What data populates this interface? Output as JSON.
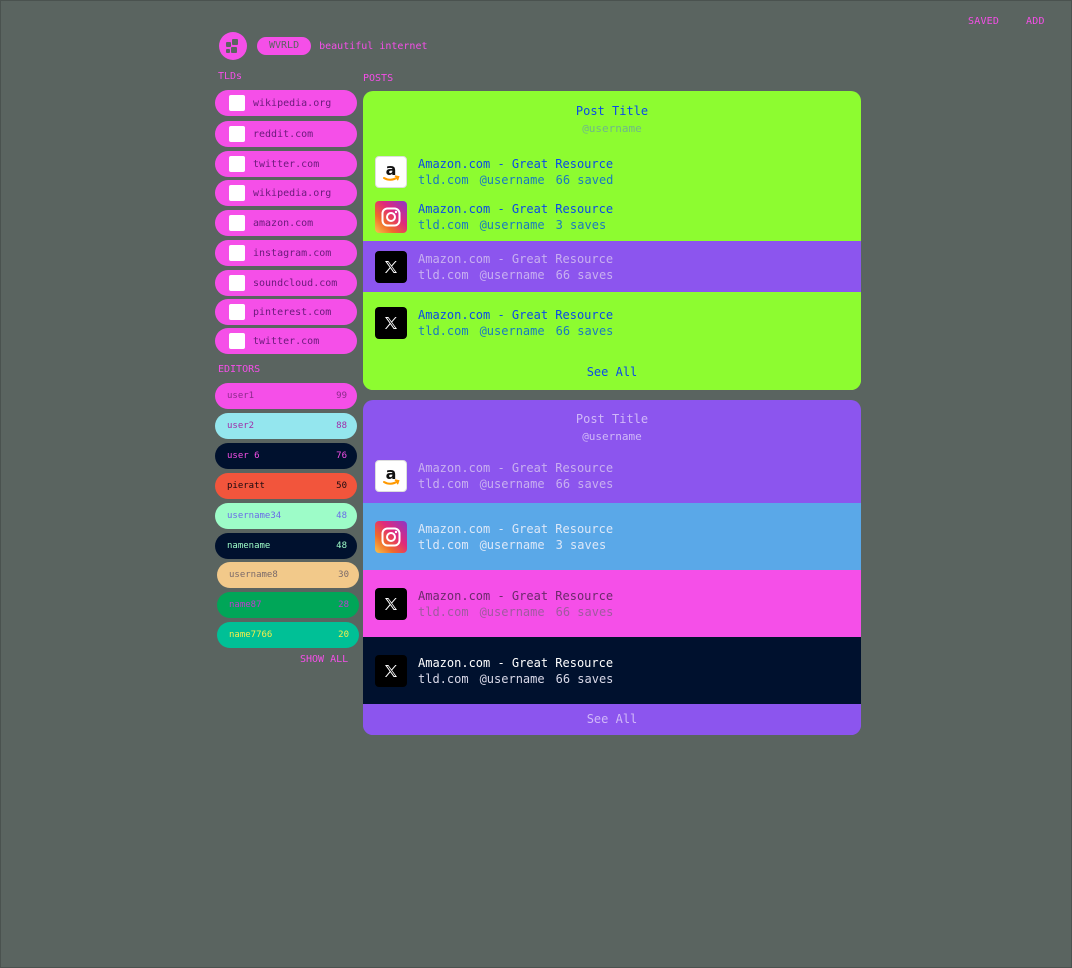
{
  "header": {
    "saved_label": "SAVED",
    "add_label": "ADD",
    "brand": "WVRLD",
    "tagline": "beautiful internet"
  },
  "sidebar": {
    "tlds_title": "TLDs",
    "tlds": [
      {
        "label": "wikipedia.org"
      },
      {
        "label": "reddit.com"
      },
      {
        "label": "twitter.com"
      },
      {
        "label": "wikipedia.org"
      },
      {
        "label": "amazon.com"
      },
      {
        "label": "instagram.com"
      },
      {
        "label": "soundcloud.com"
      },
      {
        "label": "pinterest.com"
      },
      {
        "label": "twitter.com"
      }
    ],
    "editors_title": "EDITORS",
    "editors": [
      {
        "name": "user1",
        "count": "99",
        "bg": "#f54fe8",
        "name_color": "#8a2a8a",
        "count_color": "#8a2a8a"
      },
      {
        "name": "user2",
        "count": "88",
        "bg": "#94e6ee",
        "name_color": "#a02aa8",
        "count_color": "#a02aa8"
      },
      {
        "name": "user 6",
        "count": "76",
        "bg": "#00112e",
        "name_color": "#f54fe8",
        "count_color": "#f54fe8"
      },
      {
        "name": "pieratt",
        "count": "50",
        "bg": "#f2553c",
        "name_color": "#1a0a10",
        "count_color": "#1a0a10"
      },
      {
        "name": "username34",
        "count": "48",
        "bg": "#9dfcc8",
        "name_color": "#6a6ae8",
        "count_color": "#6a6ae8"
      },
      {
        "name": "namename",
        "count": "48",
        "bg": "#00112e",
        "name_color": "#9dfcc8",
        "count_color": "#9dfcc8"
      },
      {
        "name": "username8",
        "count": "30",
        "bg": "#f2c98a",
        "name_color": "#7a6a6a",
        "count_color": "#7a6a6a"
      },
      {
        "name": "name87",
        "count": "28",
        "bg": "#00a658",
        "name_color": "#c03ad0",
        "count_color": "#c03ad0"
      },
      {
        "name": "name7766",
        "count": "20",
        "bg": "#00c096",
        "name_color": "#f5ee4a",
        "count_color": "#f5ee4a"
      }
    ],
    "show_all_label": "SHOW ALL"
  },
  "posts_title": "POSTS",
  "cards": [
    {
      "title": "Post Title",
      "username": "@username",
      "rows": [
        {
          "icon": "amazon-icon",
          "title": "Amazon.com - Great Resource",
          "domain": "tld.com",
          "user": "@username",
          "saves": "66 saved"
        },
        {
          "icon": "instagram-icon",
          "title": "Amazon.com - Great Resource",
          "domain": "tld.com",
          "user": "@username",
          "saves": "3 saves"
        },
        {
          "icon": "x-icon",
          "title": "Amazon.com - Great Resource",
          "domain": "tld.com",
          "user": "@username",
          "saves": "66 saves"
        },
        {
          "icon": "x-icon",
          "title": "Amazon.com - Great Resource",
          "domain": "tld.com",
          "user": "@username",
          "saves": "66 saves"
        }
      ],
      "see_all_label": "See All"
    },
    {
      "title": "Post Title",
      "username": "@username",
      "rows": [
        {
          "icon": "amazon-icon",
          "title": "Amazon.com - Great Resource",
          "domain": "tld.com",
          "user": "@username",
          "saves": "66 saves"
        },
        {
          "icon": "instagram-icon",
          "title": "Amazon.com - Great Resource",
          "domain": "tld.com",
          "user": "@username",
          "saves": "3 saves"
        },
        {
          "icon": "x-icon",
          "title": "Amazon.com - Great Resource",
          "domain": "tld.com",
          "user": "@username",
          "saves": "66 saves"
        },
        {
          "icon": "x-icon",
          "title": "Amazon.com - Great Resource",
          "domain": "tld.com",
          "user": "@username",
          "saves": "66 saves"
        }
      ],
      "see_all_label": "See All"
    }
  ],
  "colors": {
    "background": "#5a6460",
    "pink": "#f54fe8",
    "lime": "#8dfc30",
    "purple": "#8c55ee",
    "blue": "#5aa8e8",
    "navy": "#00112e",
    "link_blue": "#0a4ae8"
  }
}
